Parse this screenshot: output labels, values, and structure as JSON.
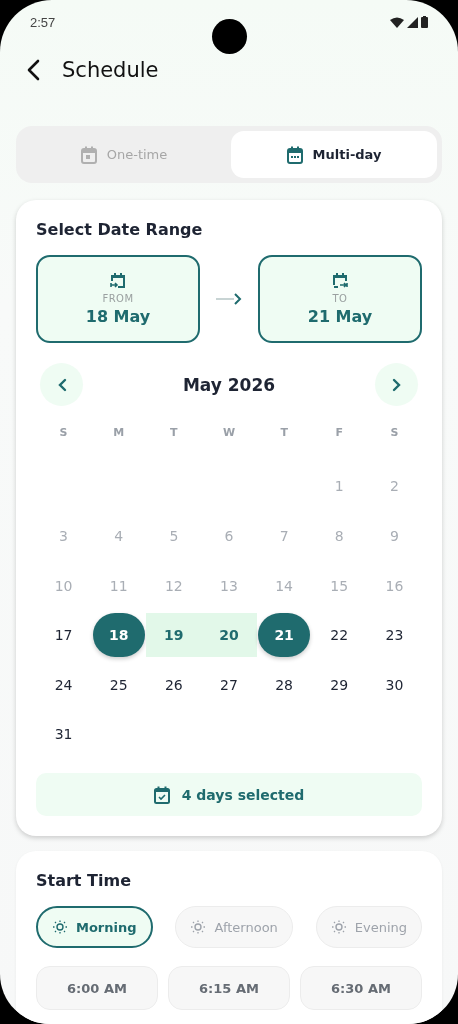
{
  "status_bar": {
    "time": "2:57"
  },
  "header": {
    "title": "Schedule"
  },
  "tabs": [
    {
      "label": "One-time",
      "selected": false
    },
    {
      "label": "Multi-day",
      "selected": true
    }
  ],
  "date_range": {
    "title": "Select Date Range",
    "from": {
      "label": "FROM",
      "value": "18 May"
    },
    "to": {
      "label": "TO",
      "value": "21 May"
    },
    "month": "May 2026",
    "weekdays": [
      "S",
      "M",
      "T",
      "W",
      "T",
      "F",
      "S"
    ],
    "weeks": [
      {
        "days": [
          {
            "kind": "empty"
          },
          {
            "kind": "empty"
          },
          {
            "kind": "empty"
          },
          {
            "kind": "empty"
          },
          {
            "kind": "empty"
          },
          {
            "label": "1",
            "kind": "past"
          },
          {
            "label": "2",
            "kind": "past"
          }
        ]
      },
      {
        "days": [
          {
            "label": "3",
            "kind": "past"
          },
          {
            "label": "4",
            "kind": "past"
          },
          {
            "label": "5",
            "kind": "past"
          },
          {
            "label": "6",
            "kind": "past"
          },
          {
            "label": "7",
            "kind": "past"
          },
          {
            "label": "8",
            "kind": "past"
          },
          {
            "label": "9",
            "kind": "past"
          }
        ]
      },
      {
        "days": [
          {
            "label": "10",
            "kind": "past"
          },
          {
            "label": "11",
            "kind": "past"
          },
          {
            "label": "12",
            "kind": "past"
          },
          {
            "label": "13",
            "kind": "past"
          },
          {
            "label": "14",
            "kind": "past"
          },
          {
            "label": "15",
            "kind": "past"
          },
          {
            "label": "16",
            "kind": "past"
          }
        ]
      },
      {
        "days": [
          {
            "label": "17",
            "kind": "normal"
          },
          {
            "label": "18",
            "kind": "start"
          },
          {
            "label": "19",
            "kind": "range"
          },
          {
            "label": "20",
            "kind": "range"
          },
          {
            "label": "21",
            "kind": "end"
          },
          {
            "label": "22",
            "kind": "normal"
          },
          {
            "label": "23",
            "kind": "normal"
          }
        ]
      },
      {
        "days": [
          {
            "label": "24",
            "kind": "normal"
          },
          {
            "label": "25",
            "kind": "normal"
          },
          {
            "label": "26",
            "kind": "normal"
          },
          {
            "label": "27",
            "kind": "normal"
          },
          {
            "label": "28",
            "kind": "normal"
          },
          {
            "label": "29",
            "kind": "normal"
          },
          {
            "label": "30",
            "kind": "normal"
          }
        ]
      },
      {
        "days": [
          {
            "label": "31",
            "kind": "normal"
          }
        ]
      }
    ],
    "summary": "4 days selected"
  },
  "start_time": {
    "title": "Start Time",
    "periods": [
      {
        "label": "Morning",
        "selected": true
      },
      {
        "label": "Afternoon",
        "selected": false
      },
      {
        "label": "Evening",
        "selected": false
      }
    ],
    "slots": [
      {
        "label": "6:00 AM"
      },
      {
        "label": "6:15 AM"
      },
      {
        "label": "6:30 AM"
      }
    ]
  }
}
